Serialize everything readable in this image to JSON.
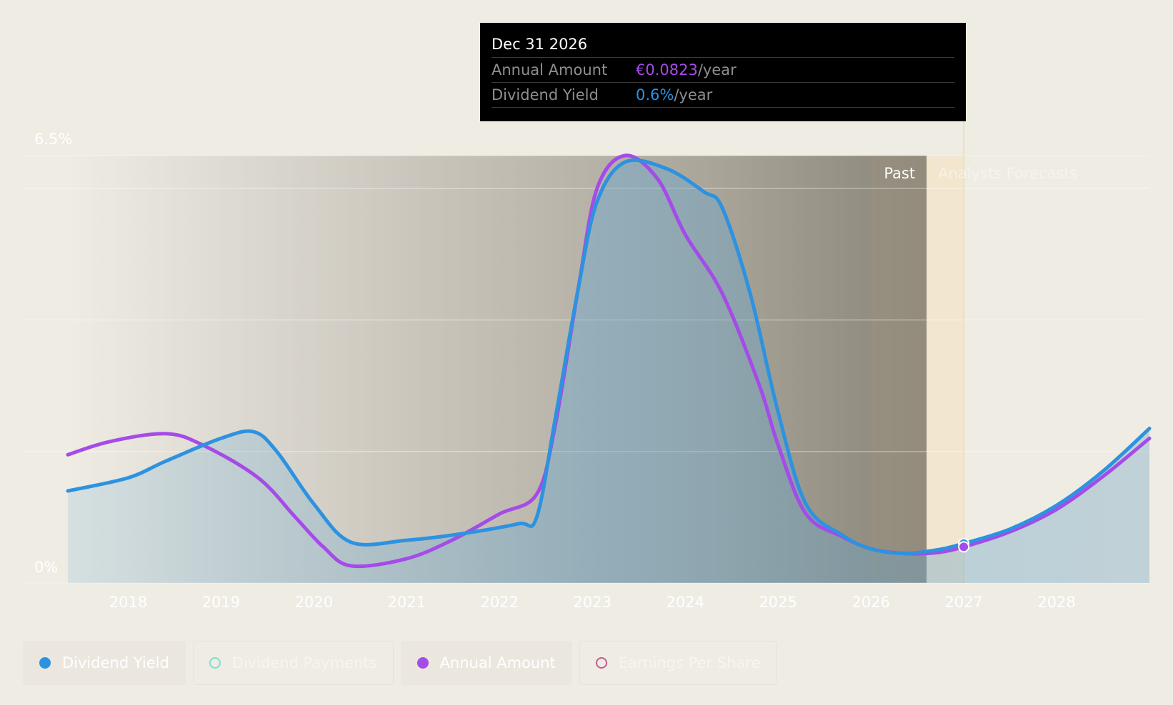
{
  "chart_data": {
    "type": "area",
    "y_axis": {
      "top_label": "6.5%",
      "bottom_label": "0%",
      "ylim": [
        0,
        6.5
      ],
      "grid": true
    },
    "x_axis": {
      "ticks": [
        "2018",
        "2019",
        "2020",
        "2021",
        "2022",
        "2023",
        "2024",
        "2025",
        "2026",
        "2027",
        "2028"
      ],
      "xlim": [
        2017.35,
        2029.0
      ]
    },
    "regions": {
      "past_label": "Past",
      "forecast_label": "Analysts Forecasts",
      "past_end": 2026.6
    },
    "series": [
      {
        "name": "Dividend Yield",
        "color": "#2d92e0",
        "points": [
          [
            2017.35,
            1.4
          ],
          [
            2018.0,
            1.6
          ],
          [
            2018.4,
            1.85
          ],
          [
            2019.0,
            2.2
          ],
          [
            2019.35,
            2.3
          ],
          [
            2019.6,
            2.0
          ],
          [
            2020.0,
            1.2
          ],
          [
            2020.4,
            0.62
          ],
          [
            2021.0,
            0.65
          ],
          [
            2021.6,
            0.75
          ],
          [
            2022.2,
            0.9
          ],
          [
            2022.4,
            1.0
          ],
          [
            2022.6,
            2.5
          ],
          [
            2022.85,
            4.5
          ],
          [
            2023.05,
            5.8
          ],
          [
            2023.35,
            6.4
          ],
          [
            2023.8,
            6.3
          ],
          [
            2024.2,
            5.95
          ],
          [
            2024.4,
            5.7
          ],
          [
            2024.7,
            4.4
          ],
          [
            2025.0,
            2.6
          ],
          [
            2025.3,
            1.2
          ],
          [
            2025.7,
            0.72
          ],
          [
            2026.0,
            0.52
          ],
          [
            2026.35,
            0.45
          ],
          [
            2026.7,
            0.5
          ],
          [
            2027.0,
            0.6
          ],
          [
            2027.5,
            0.82
          ],
          [
            2028.0,
            1.18
          ],
          [
            2028.5,
            1.7
          ],
          [
            2029.0,
            2.35
          ]
        ]
      },
      {
        "name": "Annual Amount",
        "color": "#a44be8",
        "points": [
          [
            2017.35,
            1.95
          ],
          [
            2017.8,
            2.15
          ],
          [
            2018.4,
            2.27
          ],
          [
            2018.8,
            2.1
          ],
          [
            2019.4,
            1.6
          ],
          [
            2019.8,
            1.0
          ],
          [
            2020.1,
            0.55
          ],
          [
            2020.4,
            0.26
          ],
          [
            2021.0,
            0.37
          ],
          [
            2021.5,
            0.66
          ],
          [
            2022.0,
            1.05
          ],
          [
            2022.4,
            1.35
          ],
          [
            2022.6,
            2.4
          ],
          [
            2022.85,
            4.5
          ],
          [
            2023.05,
            6.0
          ],
          [
            2023.35,
            6.5
          ],
          [
            2023.7,
            6.15
          ],
          [
            2024.0,
            5.3
          ],
          [
            2024.4,
            4.4
          ],
          [
            2024.8,
            3.0
          ],
          [
            2025.0,
            2.1
          ],
          [
            2025.3,
            1.05
          ],
          [
            2025.7,
            0.7
          ],
          [
            2026.0,
            0.52
          ],
          [
            2026.35,
            0.45
          ],
          [
            2026.7,
            0.46
          ],
          [
            2027.0,
            0.55
          ],
          [
            2027.5,
            0.78
          ],
          [
            2028.0,
            1.12
          ],
          [
            2028.5,
            1.62
          ],
          [
            2029.0,
            2.2
          ]
        ]
      }
    ],
    "highlight": {
      "x": 2027.0,
      "date": "Dec 31 2026",
      "annual_amount_label": "Annual Amount",
      "annual_amount_value": "€0.0823",
      "annual_amount_unit": "/year",
      "yield_label": "Dividend Yield",
      "yield_value": "0.6%",
      "yield_unit": "/year",
      "yield_y": 0.6,
      "amount_y": 0.55
    },
    "legend": [
      {
        "label": "Dividend Yield",
        "color": "#2d92e0",
        "style": "filled",
        "active": true
      },
      {
        "label": "Dividend Payments",
        "color": "#7ee0d0",
        "style": "hollow",
        "active": false
      },
      {
        "label": "Annual Amount",
        "color": "#a44be8",
        "style": "filled",
        "active": true
      },
      {
        "label": "Earnings Per Share",
        "color": "#c65a8e",
        "style": "hollow",
        "active": false
      }
    ]
  }
}
